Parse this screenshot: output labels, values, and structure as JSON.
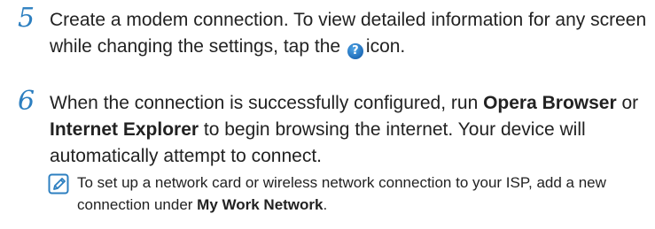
{
  "steps": [
    {
      "number": "5",
      "text_before_icon": "Create a modem connection. To view detailed information for any screen while changing the settings, tap the",
      "icon": "help-icon",
      "text_after_icon": "icon."
    },
    {
      "number": "6",
      "text_part1": "When the connection is successfully configured, run ",
      "bold1": "Opera Browser",
      "text_part2": " or ",
      "bold2": "Internet Explorer",
      "text_part3": " to begin browsing the internet. Your device will automatically attempt to connect."
    }
  ],
  "note": {
    "icon": "note-pencil-icon",
    "text_part1": "To set up a network card or wireless network connection to your ISP, add a new connection under ",
    "bold": "My Work Network",
    "text_part2": "."
  },
  "colors": {
    "step_number": "#2d7fc0",
    "text": "#222222",
    "help_icon": "#1f6cb8",
    "note_icon": "#2d7fc0"
  }
}
